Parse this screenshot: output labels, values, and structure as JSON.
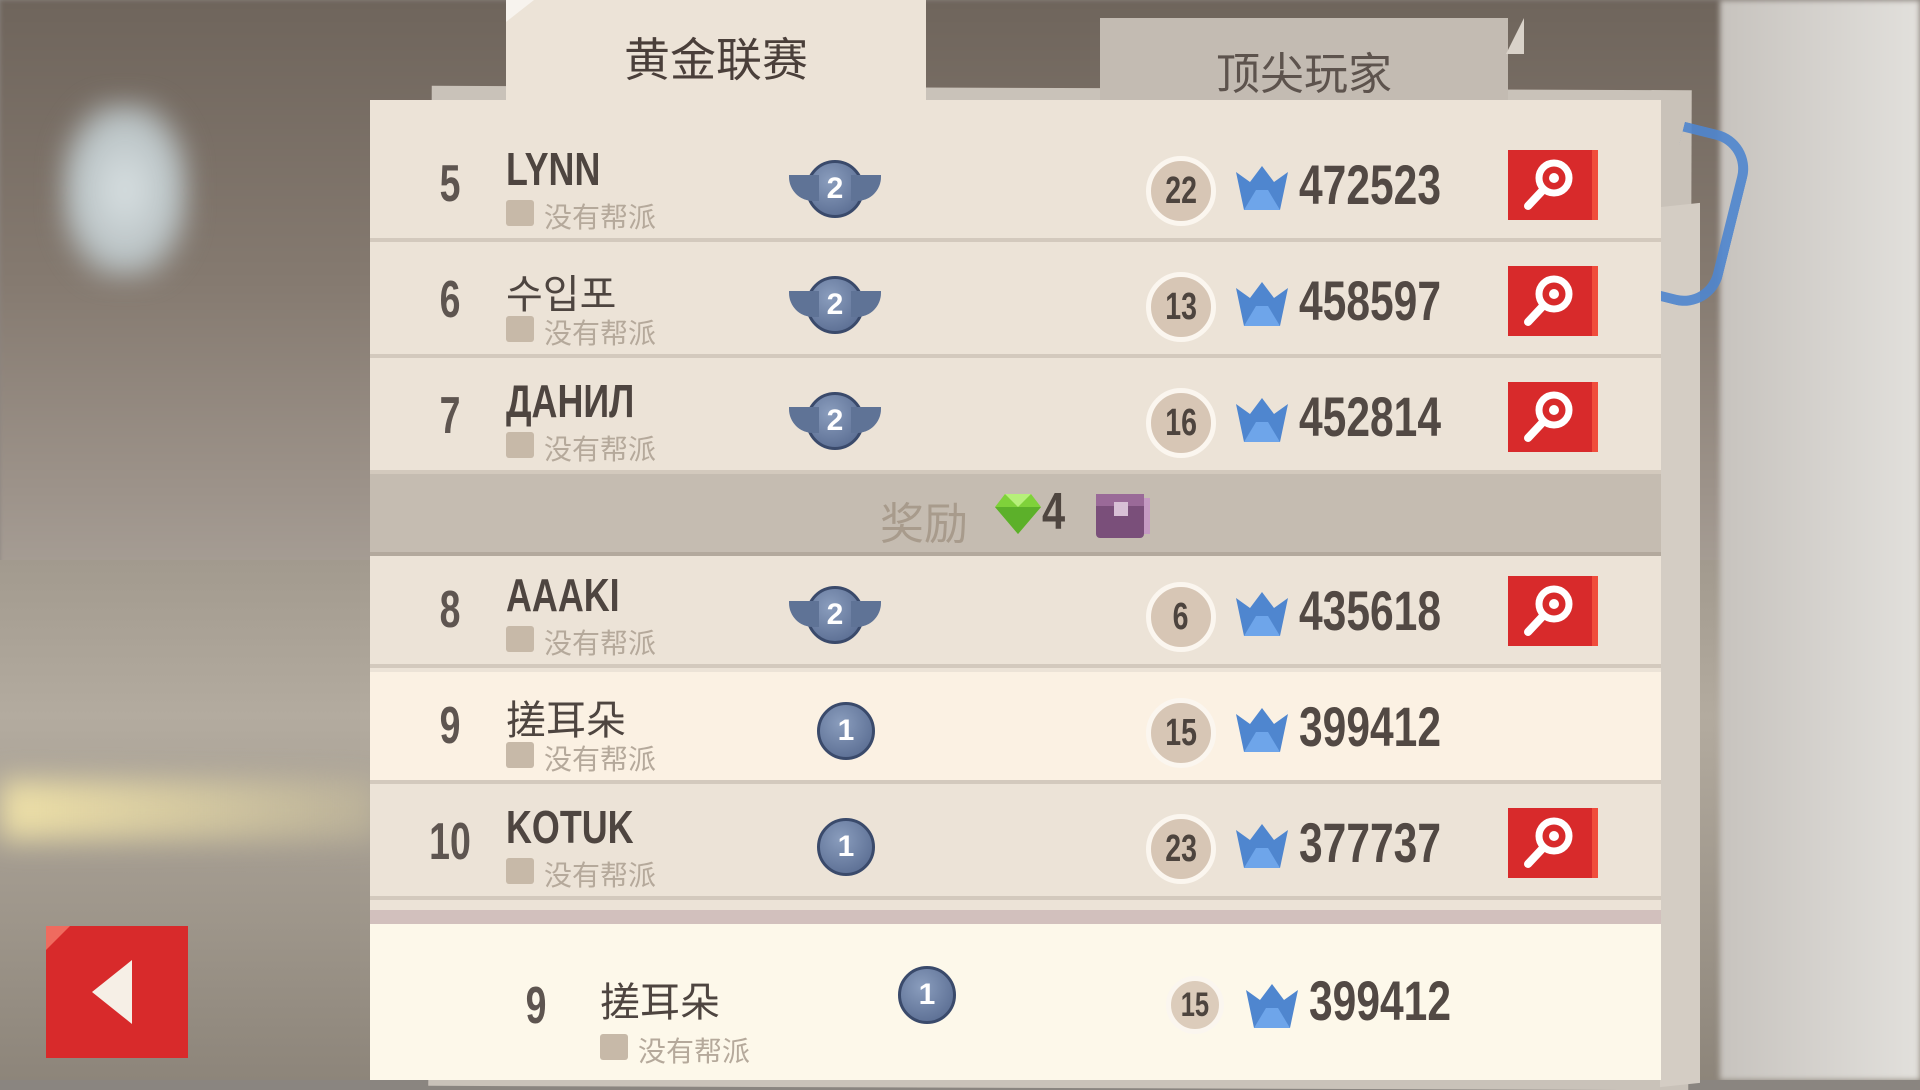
{
  "tabs": [
    {
      "label": "黄金联赛",
      "active": true
    },
    {
      "label": "顶尖玩家",
      "active": false
    }
  ],
  "leaderboard": [
    {
      "rank": "5",
      "name": "LYNN",
      "clan": "没有帮派",
      "badge": "2",
      "level": "22",
      "score": "472523",
      "inspect": true,
      "highlight": false
    },
    {
      "rank": "6",
      "name": "수입포",
      "clan": "没有帮派",
      "badge": "2",
      "level": "13",
      "score": "458597",
      "inspect": true,
      "highlight": false
    },
    {
      "rank": "7",
      "name": "ДАНИЛ",
      "clan": "没有帮派",
      "badge": "2",
      "level": "16",
      "score": "452814",
      "inspect": true,
      "highlight": false
    },
    {
      "rank": "8",
      "name": "AAAKI",
      "clan": "没有帮派",
      "badge": "2",
      "level": "6",
      "score": "435618",
      "inspect": true,
      "highlight": false
    },
    {
      "rank": "9",
      "name": "搓耳朵",
      "clan": "没有帮派",
      "badge": "1",
      "level": "15",
      "score": "399412",
      "inspect": false,
      "highlight": true
    },
    {
      "rank": "10",
      "name": "KOTUK",
      "clan": "没有帮派",
      "badge": "1",
      "level": "23",
      "score": "377737",
      "inspect": true,
      "highlight": false
    }
  ],
  "reward": {
    "label": "奖励",
    "gem_count": "4"
  },
  "current_player": {
    "rank": "9",
    "name": "搓耳朵",
    "clan": "没有帮派",
    "badge": "1",
    "level": "15",
    "score": "399412"
  },
  "colors": {
    "accent_red": "#d82a2b",
    "trophy_blue": "#4f86cf",
    "gem_green": "#7fd23a",
    "chest_purple": "#7a4f7a"
  },
  "icons": {
    "score": "blue-cat-trophy-icon",
    "inspect": "magnifier-icon",
    "back": "back-arrow-icon",
    "gem": "green-gem-icon",
    "chest": "purple-chest-icon"
  }
}
